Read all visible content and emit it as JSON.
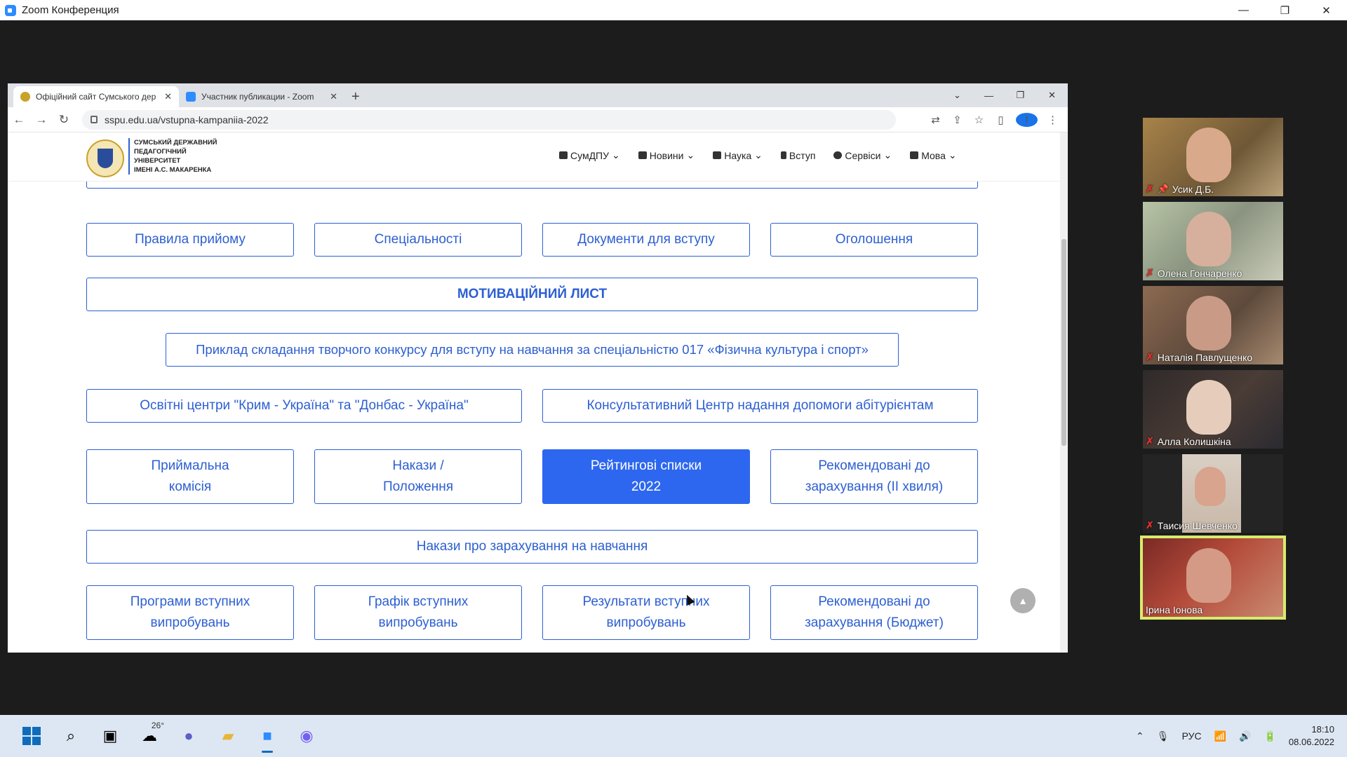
{
  "zoom_window": {
    "title": "Zoom Конференция",
    "controls": [
      "—",
      "❐",
      "✕"
    ]
  },
  "browser": {
    "tabs": [
      {
        "label": "Офіційний сайт Сумського дер",
        "active": true,
        "close": "✕"
      },
      {
        "label": "Участник публикации - Zoom",
        "active": false,
        "close": "✕"
      }
    ],
    "new_tab": "+",
    "window_controls": [
      "⌄",
      "—",
      "❐",
      "✕"
    ],
    "url": "sspu.edu.ua/vstupna-kampaniia-2022",
    "profile_initial": "I"
  },
  "site": {
    "name_line1": "СУМСЬКИЙ ДЕРЖАВНИЙ",
    "name_line2": "ПЕДАГОГІЧНИЙ УНІВЕРСИТЕТ",
    "name_line3": "ІМЕНІ А.С. МАКАРЕНКА",
    "menu": [
      "СумДПУ",
      "Новини",
      "Наука",
      "Вступ",
      "Сервіси",
      "Мова"
    ]
  },
  "buttons": {
    "rules": "Правила прийому",
    "specialties": "Спеціальності",
    "documents": "Документи для вступу",
    "announcements": "Оголошення",
    "motivation_letter": "МОТИВАЦІЙНИЙ ЛИСТ",
    "creative_contest": "Приклад складання творчого конкурсу для вступу на навчання за спеціальністю 017 «Фізична культура і спорт»",
    "edu_centers": "Освітні центри \"Крим - Україна\" та \"Донбас - Україна\"",
    "consult_center": "Консультативний Центр надання допомоги абітурієнтам",
    "admission_committee_l1": "Приймальна",
    "admission_committee_l2": "комісія",
    "orders_l1": "Накази /",
    "orders_l2": "Положення",
    "rating_l1": "Рейтингові списки",
    "rating_l2": "2022",
    "recommended2_l1": "Рекомендовані до",
    "recommended2_l2": "зарахування (ІІ хвиля)",
    "enrollment_orders": "Накази про зарахування на навчання",
    "programs_l1": "Програми вступних",
    "programs_l2": "випробувань",
    "schedule_l1": "Графік вступних",
    "schedule_l2": "випробувань",
    "results_l1": "Результати вступних",
    "results_l2": "випробувань",
    "recommended_budget_l1": "Рекомендовані до",
    "recommended_budget_l2": "зарахування (Бюджет)"
  },
  "participants": [
    {
      "name": "Усик Д.Б.",
      "muted": true,
      "pinned": true
    },
    {
      "name": "Олена Гончаренко",
      "muted": true
    },
    {
      "name": "Наталія Павлущенко",
      "muted": true
    },
    {
      "name": "Алла Колишкіна",
      "muted": true
    },
    {
      "name": "Таисия Шевченко",
      "muted": true
    },
    {
      "name": "Ірина Іонова",
      "muted": false,
      "speaking": true
    }
  ],
  "taskbar": {
    "weather_temp": "26°",
    "language": "РУС",
    "time": "18:10",
    "date": "08.06.2022"
  },
  "colors": {
    "site_accent": "#2d5fd2",
    "active_button": "#2d67ef",
    "speaker_highlight": "#d6ec6d"
  }
}
